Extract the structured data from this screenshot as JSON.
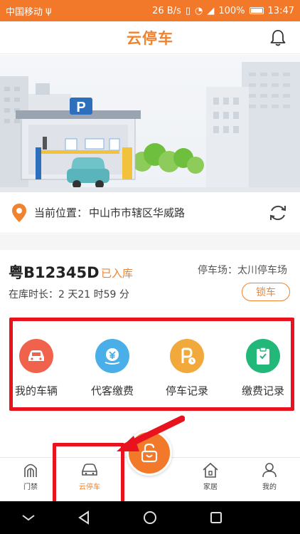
{
  "status_bar": {
    "carrier": "中国移动",
    "network_speed": "26 B/s",
    "battery_percent": "100%",
    "time": "13:47"
  },
  "header": {
    "title": "云停车",
    "bell_icon": "bell-icon"
  },
  "banner": {
    "sign_letter": "P"
  },
  "location": {
    "label": "当前位置：",
    "value": "中山市市辖区华威路"
  },
  "car": {
    "plate": "粤B12345D",
    "status": "已入库",
    "duration": "在库时长：2 天21 时59 分",
    "lot": "停车场：太川停车场",
    "lock_label": "锁车"
  },
  "functions": [
    {
      "label": "我的车辆",
      "icon": "car-icon",
      "color": "#f0624b"
    },
    {
      "label": "代客缴费",
      "icon": "payment-icon",
      "color": "#4aaee8"
    },
    {
      "label": "停车记录",
      "icon": "parking-record-icon",
      "color": "#f2a93b"
    },
    {
      "label": "缴费记录",
      "icon": "clipboard-icon",
      "color": "#21b87a"
    }
  ],
  "tabs": [
    {
      "label": "门禁",
      "icon": "gate-icon"
    },
    {
      "label": "云停车",
      "icon": "car-icon"
    },
    {
      "label": "家居",
      "icon": "home-icon"
    },
    {
      "label": "我的",
      "icon": "user-icon"
    }
  ],
  "colors": {
    "accent": "#f0832f",
    "highlight": "#e8131f"
  }
}
